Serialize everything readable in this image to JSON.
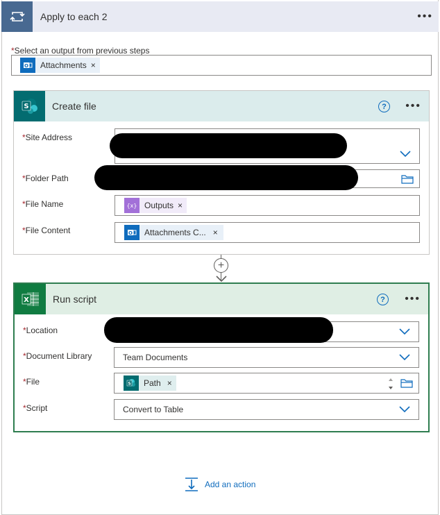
{
  "apply_each": {
    "title": "Apply to each 2",
    "more": "•••",
    "select_label": "Select an output from previous steps",
    "token": {
      "label": "Attachments",
      "icon": "outlook-icon"
    }
  },
  "create_file": {
    "title": "Create file",
    "help": "?",
    "more": "•••",
    "fields": {
      "site_address": "Site Address",
      "folder_path": "Folder Path",
      "file_name": "File Name",
      "file_content": "File Content"
    },
    "file_name_token": {
      "label": "Outputs",
      "icon": "expression-icon"
    },
    "file_content_token": {
      "label": "Attachments C...",
      "icon": "outlook-icon"
    }
  },
  "run_script": {
    "title": "Run script",
    "help": "?",
    "more": "•••",
    "fields": {
      "location": "Location",
      "document_library": "Document Library",
      "file": "File",
      "script": "Script"
    },
    "document_library_value": "Team Documents",
    "file_token": {
      "label": "Path",
      "icon": "sharepoint-icon"
    },
    "script_value": "Convert to Table"
  },
  "add_action": {
    "label": "Add an action"
  },
  "required_marker": "*",
  "token_remove": "×",
  "plus": "+",
  "colors": {
    "loop_accent": "#486991",
    "sharepoint_accent": "#036c70",
    "excel_accent": "#107c41",
    "outlook_accent": "#0f6cbd",
    "expression_accent": "#a270d8",
    "link": "#0f6cbd",
    "required": "#a4262c"
  }
}
